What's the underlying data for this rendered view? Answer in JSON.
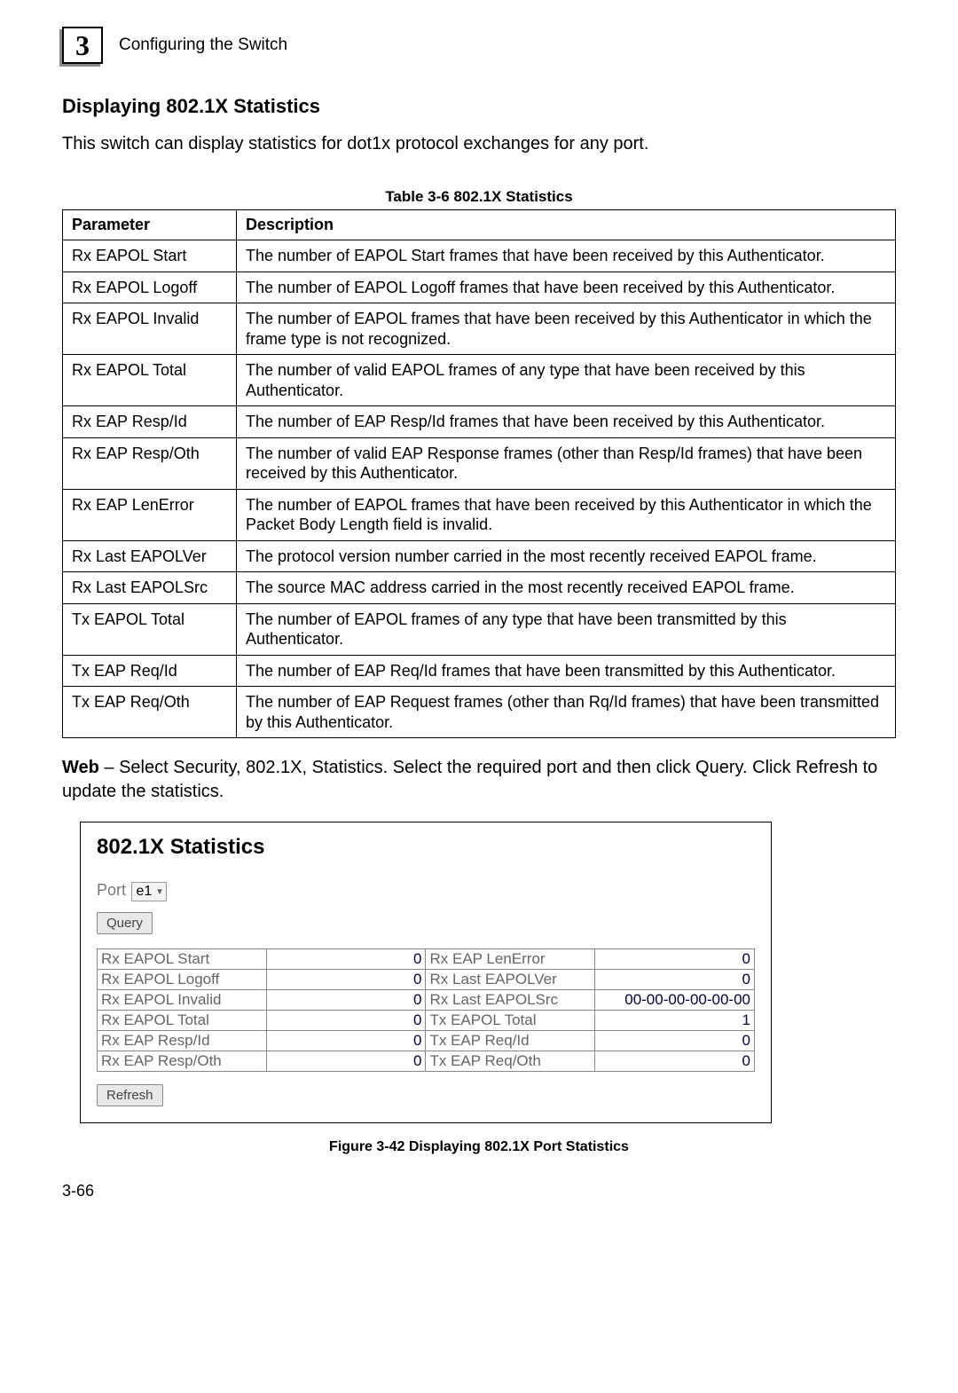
{
  "chapter": {
    "number": "3",
    "title": "Configuring the Switch"
  },
  "section": {
    "heading": "Displaying 802.1X Statistics"
  },
  "intro": "This switch can display statistics for dot1x protocol exchanges for any port.",
  "table": {
    "caption": "Table 3-6  802.1X Statistics",
    "head": {
      "param": "Parameter",
      "desc": "Description"
    },
    "rows": [
      {
        "param": "Rx EAPOL Start",
        "desc": "The number of EAPOL Start frames that have been received by this Authenticator."
      },
      {
        "param": "Rx EAPOL Logoff",
        "desc": "The number of EAPOL Logoff frames that have been received by this Authenticator."
      },
      {
        "param": "Rx EAPOL Invalid",
        "desc": "The number of EAPOL frames that have been received by this Authenticator in which the frame type is not recognized."
      },
      {
        "param": "Rx EAPOL Total",
        "desc": "The number of valid EAPOL frames of any type that have been received by this Authenticator."
      },
      {
        "param": "Rx EAP Resp/Id",
        "desc": "The number of EAP Resp/Id frames that have been received by this Authenticator."
      },
      {
        "param": "Rx EAP Resp/Oth",
        "desc": "The number of valid EAP Response frames (other than Resp/Id frames) that have been received by this Authenticator."
      },
      {
        "param": "Rx EAP LenError",
        "desc": "The number of EAPOL frames that have been received by this Authenticator in which the Packet Body Length field is invalid."
      },
      {
        "param": "Rx Last EAPOLVer",
        "desc": "The protocol version number carried in the most recently received EAPOL frame."
      },
      {
        "param": "Rx Last EAPOLSrc",
        "desc": "The source MAC address carried in the most recently received EAPOL frame."
      },
      {
        "param": "Tx EAPOL Total",
        "desc": "The number of EAPOL frames of any type that have been transmitted by this Authenticator."
      },
      {
        "param": "Tx EAP Req/Id",
        "desc": "The number of EAP Req/Id frames that have been transmitted by this Authenticator."
      },
      {
        "param": "Tx EAP Req/Oth",
        "desc": "The number of EAP Request frames (other than Rq/Id frames) that have been transmitted by this Authenticator."
      }
    ]
  },
  "webNote": {
    "bold": "Web",
    "text": " – Select Security, 802.1X, Statistics. Select the required port and then click Query. Click Refresh to update the statistics."
  },
  "panel": {
    "title": "802.1X Statistics",
    "portLabel": "Port",
    "portValue": "e1",
    "queryBtn": "Query",
    "refreshBtn": "Refresh",
    "leftRows": [
      {
        "label": "Rx EAPOL Start",
        "val": "0"
      },
      {
        "label": "Rx EAPOL Logoff",
        "val": "0"
      },
      {
        "label": "Rx EAPOL Invalid",
        "val": "0"
      },
      {
        "label": "Rx EAPOL Total",
        "val": "0"
      },
      {
        "label": "Rx EAP Resp/Id",
        "val": "0"
      },
      {
        "label": "Rx EAP Resp/Oth",
        "val": "0"
      }
    ],
    "rightRows": [
      {
        "label": "Rx EAP LenError",
        "val": "0"
      },
      {
        "label": "Rx Last EAPOLVer",
        "val": "0"
      },
      {
        "label": "Rx Last EAPOLSrc",
        "val": "00-00-00-00-00-00"
      },
      {
        "label": "Tx EAPOL Total",
        "val": "1"
      },
      {
        "label": "Tx EAP Req/Id",
        "val": "0"
      },
      {
        "label": "Tx EAP Req/Oth",
        "val": "0"
      }
    ]
  },
  "figureCaption": "Figure 3-42  Displaying 802.1X Port Statistics",
  "pageNum": "3-66"
}
